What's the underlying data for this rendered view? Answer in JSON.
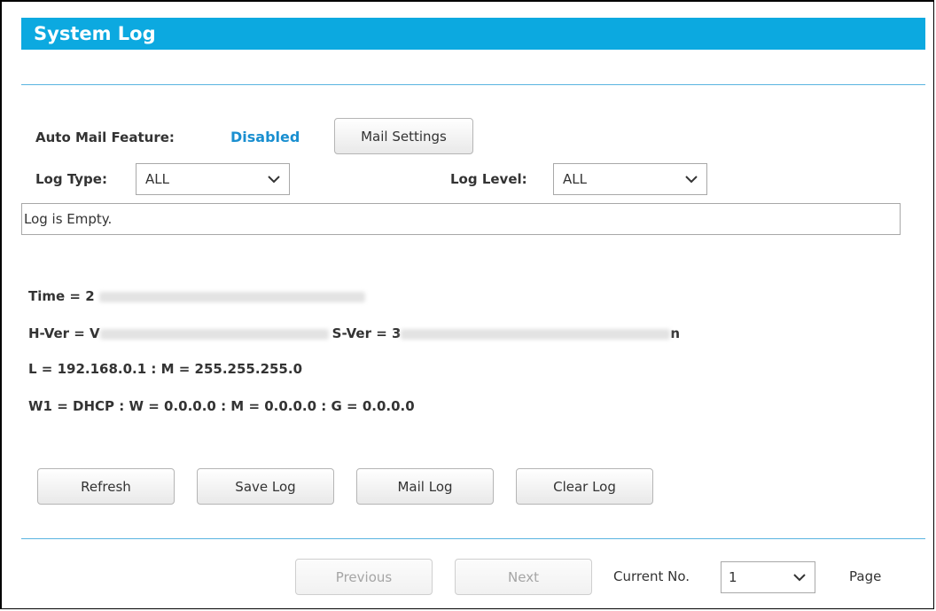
{
  "header": {
    "title": "System Log"
  },
  "mail": {
    "label": "Auto Mail Feature:",
    "status": "Disabled",
    "settings_button": "Mail Settings"
  },
  "filters": {
    "log_type_label": "Log Type:",
    "log_type_value": "ALL",
    "log_level_label": "Log Level:",
    "log_level_value": "ALL"
  },
  "log": {
    "content": "Log is Empty."
  },
  "info": {
    "time_prefix": "Time = 2",
    "hver_prefix": "H-Ver = V",
    "sver_prefix": "S-Ver = 3",
    "sver_suffix": "n",
    "lan_line": "L = 192.168.0.1 : M = 255.255.255.0",
    "wan_line": "W1 = DHCP : W = 0.0.0.0 : M = 0.0.0.0 : G = 0.0.0.0"
  },
  "actions": {
    "refresh": "Refresh",
    "save_log": "Save Log",
    "mail_log": "Mail Log",
    "clear_log": "Clear Log"
  },
  "pager": {
    "previous": "Previous",
    "next": "Next",
    "current_label": "Current No.",
    "current_value": "1",
    "page_label": "Page"
  },
  "colors": {
    "title_bar": "#0ca9e0",
    "status_text": "#1a8fd0",
    "rule": "#5ab4e0"
  }
}
